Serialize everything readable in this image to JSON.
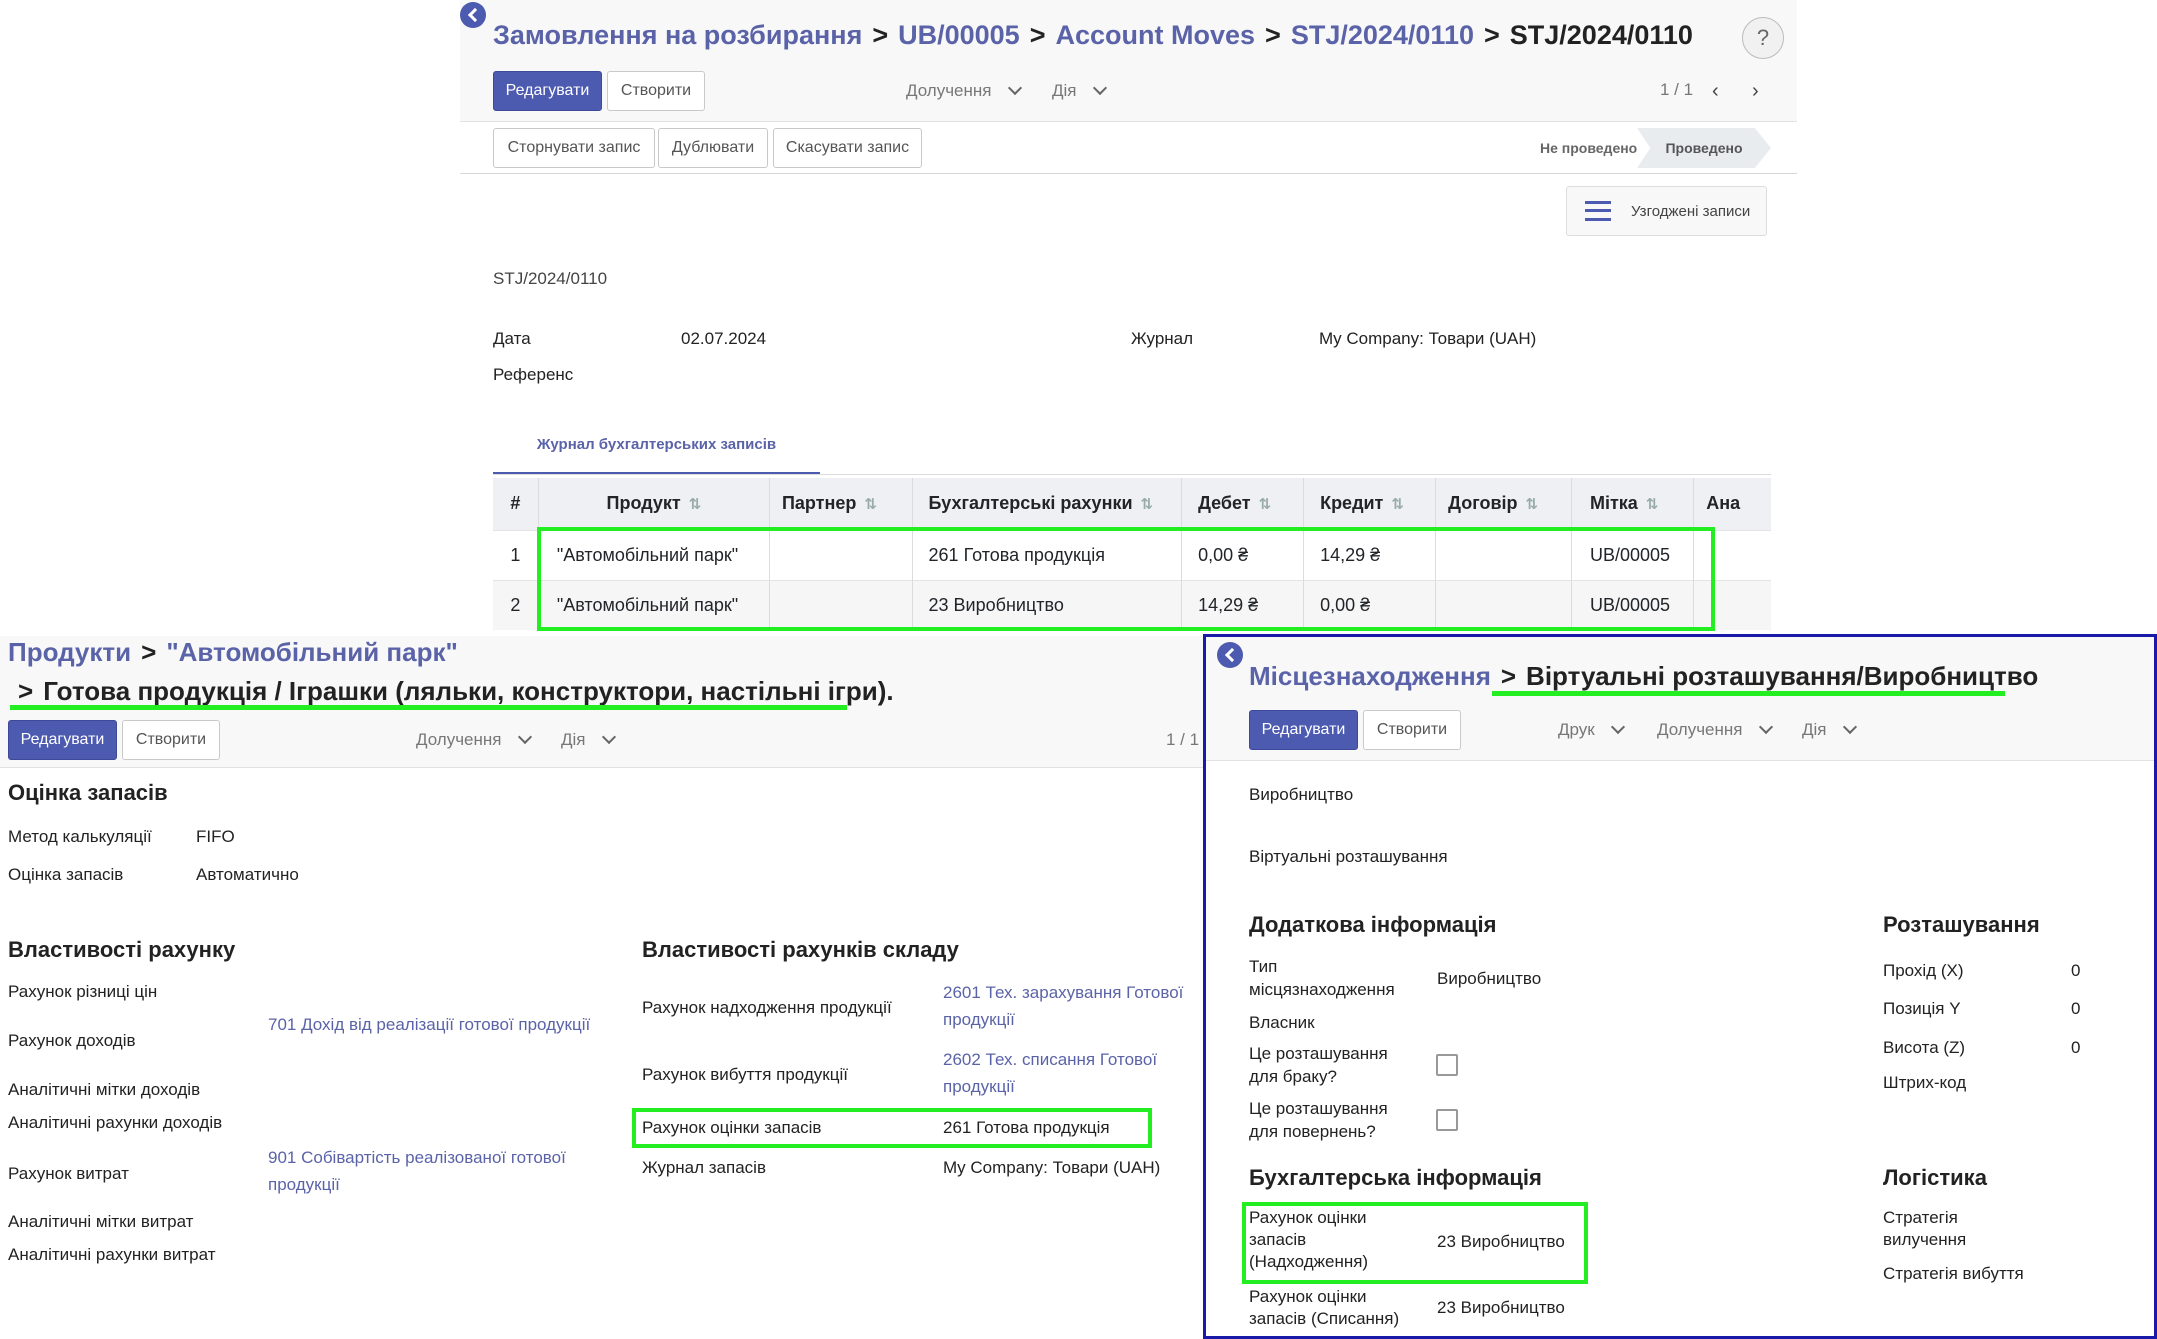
{
  "top": {
    "breadcrumb": [
      "Замовлення на розбирання",
      "UB/00005",
      "Account Moves",
      "STJ/2024/0110"
    ],
    "current": "STJ/2024/0110",
    "edit": "Редагувати",
    "create": "Створити",
    "attach": "Долучення",
    "action": "Дія",
    "pager": "1 / 1",
    "help": "?",
    "btn_reverse": "Сторнувати запис",
    "btn_duplicate": "Дублювати",
    "btn_cancel": "Скасувати запис",
    "status_draft": "Не проведено",
    "status_posted": "Проведено",
    "reconciled": "Узгоджені записи",
    "ref_name": "STJ/2024/0110",
    "date_label": "Дата",
    "date": "02.07.2024",
    "journal_label": "Журнал",
    "journal": "My Company: Товари (UAH)",
    "ref_label": "Референс",
    "tab": "Журнал бухгалтерських записів",
    "table": {
      "headers": [
        "#",
        "Продукт",
        "Партнер",
        "Бухгалтерські рахунки",
        "Дебет",
        "Кредит",
        "Договір",
        "Мітка",
        "Ана"
      ],
      "rows": [
        [
          "1",
          "\"Автомобільний парк\"",
          "",
          "261 Готова продукція",
          "0,00 ₴",
          "14,29 ₴",
          "",
          "UB/00005",
          ""
        ],
        [
          "2",
          "\"Автомобільний парк\"",
          "",
          "23 Виробництво",
          "14,29 ₴",
          "0,00 ₴",
          "",
          "UB/00005",
          ""
        ]
      ]
    }
  },
  "left": {
    "bc1": "Продукти",
    "bc2": "\"Автомобільний парк\"",
    "bc3": "Готова продукція / Іграшки (ляльки, конструктори, настільні ігри).",
    "edit": "Редагувати",
    "create": "Створити",
    "attach": "Долучення",
    "action": "Дія",
    "pager": "1 / 1",
    "valuation_title": "Оцінка запасів",
    "cost_method_label": "Метод калькуляції",
    "cost_method": "FIFO",
    "valuation_label": "Оцінка запасів",
    "valuation": "Автоматично",
    "acc_props": "Властивості рахунку",
    "price_diff": "Рахунок різниці цін",
    "income_label": "Рахунок доходів",
    "income": "701 Дохід від реалізації готової продукції",
    "income_tags": "Аналітичні мітки доходів",
    "income_analytic": "Аналітичні рахунки доходів",
    "expense_label": "Рахунок витрат",
    "expense": "901 Собівартість реалізованої готової продукції",
    "expense_tags": "Аналітичні мітки витрат",
    "expense_analytic": "Аналітичні рахунки витрат",
    "stock_props": "Властивості рахунків складу",
    "stock_in_label": "Рахунок надходження продукції",
    "stock_in": "2601 Тех. зарахування Готової продукції",
    "stock_out_label": "Рахунок вибуття продукції",
    "stock_out": "2602 Тех. списання Готової продукції",
    "stock_val_label": "Рахунок оцінки запасів",
    "stock_val": "261 Готова продукція",
    "stock_journal_label": "Журнал запасів",
    "stock_journal": "My Company: Товари (UAH)"
  },
  "right": {
    "bc1": "Місцезнаходження",
    "bc2": "Віртуальні розташування/Виробництво",
    "edit": "Редагувати",
    "create": "Створити",
    "print": "Друк",
    "attach": "Долучення",
    "action": "Дія",
    "name": "Виробництво",
    "parent": "Віртуальні розташування",
    "extra_title": "Додаткова інформація",
    "type_label": "Тип місцязнаходження",
    "type": "Виробництво",
    "owner_label": "Власник",
    "scrap_label": "Це розташування для браку?",
    "return_label": "Це розташування для повернень?",
    "loc_title": "Розташування",
    "x_label": "Прохід (X)",
    "x": "0",
    "y_label": "Позиція Y",
    "y": "0",
    "z_label": "Висота (Z)",
    "z": "0",
    "barcode_label": "Штрих-код",
    "acc_title": "Бухгалтерська інформація",
    "val_in_label": "Рахунок оцінки запасів (Надходження)",
    "val_in": "23 Виробництво",
    "val_out_label": "Рахунок оцінки запасів (Списання)",
    "val_out": "23 Виробництво",
    "log_title": "Логістика",
    "removal_label": "Стратегія вилучення",
    "outgoing_label": "Стратегія вибуття"
  },
  "colors": {
    "accent": "#5b63a8",
    "primary": "#4c5ab0",
    "highlight": "#22ee22",
    "frame": "#1a1aa8"
  }
}
